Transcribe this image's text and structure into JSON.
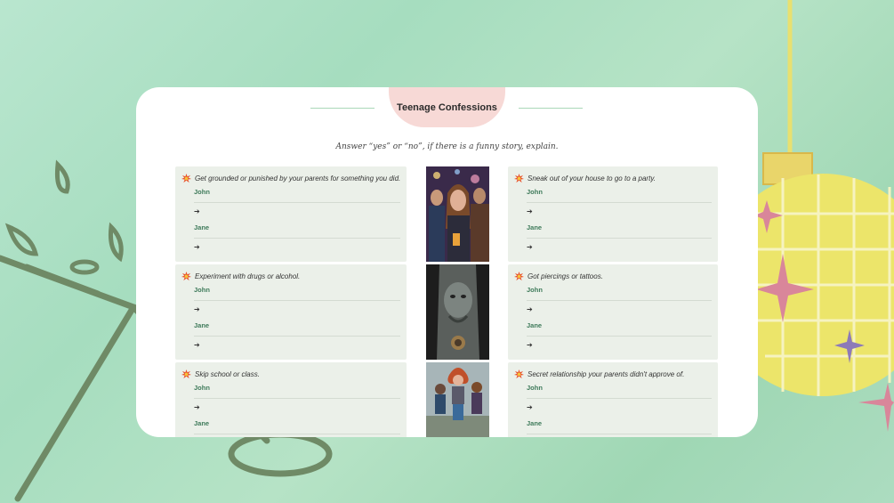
{
  "title": "Teenage Confessions",
  "subtitle": "Answer “yes” or “no”, if there is a funny story, explain.",
  "colors": {
    "accent_green": "#3e7a5a",
    "pill_pink": "#f7d9d6",
    "box_bg": "#ebf0e9",
    "background": "#a6ddbf"
  },
  "burst_icon": "explosion-icon",
  "arrow_glyph": "➔",
  "left_questions": [
    {
      "text": "Get grounded or punished by your parents for something you did.",
      "names": [
        "John",
        "Jane"
      ]
    },
    {
      "text": "Experiment with drugs or alcohol.",
      "names": [
        "John",
        "Jane"
      ]
    },
    {
      "text": "Skip school or class.",
      "names": [
        "John",
        "Jane"
      ]
    }
  ],
  "right_questions": [
    {
      "text": "Sneak out of your house to go to a party.",
      "names": [
        "John",
        "Jane"
      ]
    },
    {
      "text": "Got piercings or tattoos.",
      "names": [
        "John",
        "Jane"
      ]
    },
    {
      "text": "Secret relationship your parents didn't approve of.",
      "names": [
        "John",
        "Jane"
      ]
    }
  ],
  "photos": [
    "party-photo",
    "tattoo-photo",
    "running-teens-photo"
  ]
}
